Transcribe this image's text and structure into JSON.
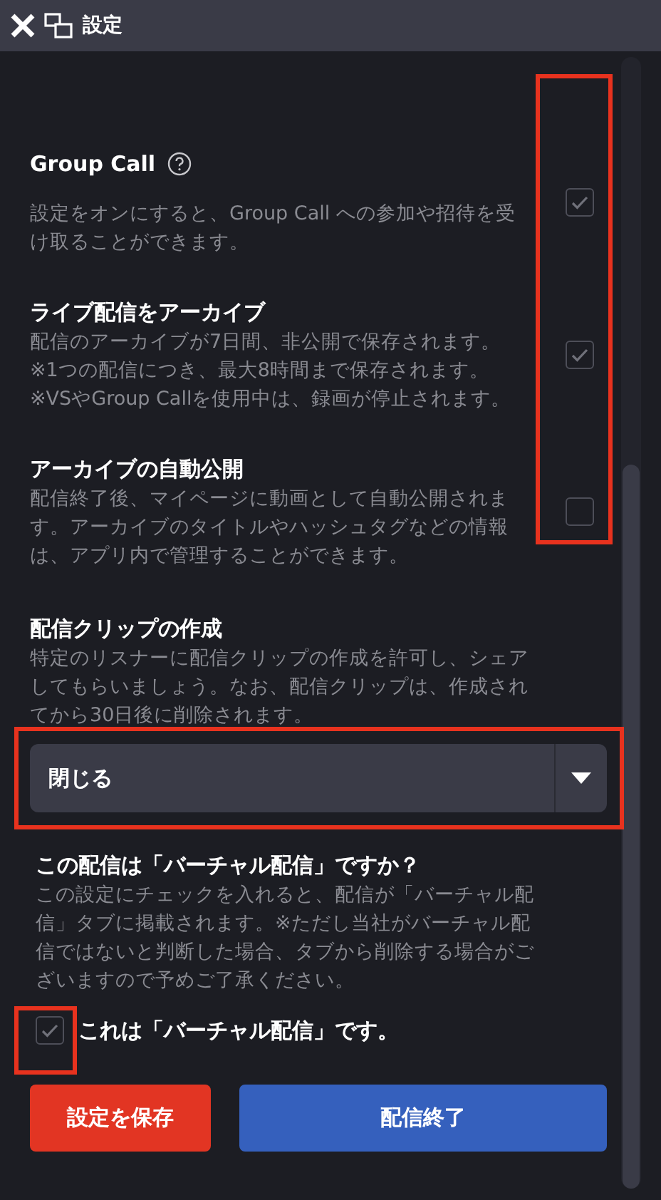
{
  "window": {
    "title": "設定"
  },
  "settings": [
    {
      "title": "Group Call",
      "help": true,
      "description": [
        "設定をオンにすると、Group Call への参加や招待を受け取ることができます。"
      ],
      "checked": true
    },
    {
      "title": "ライブ配信をアーカイブ",
      "help": false,
      "description": [
        "配信のアーカイブが7日間、非公開で保存されます。",
        "※1つの配信につき、最大8時間まで保存されます。",
        "※VSやGroup Callを使用中は、録画が停止されます。"
      ],
      "checked": true
    },
    {
      "title": "アーカイブの自動公開",
      "help": false,
      "description": [
        "配信終了後、マイページに動画として自動公開されます。アーカイブのタイトルやハッシュタグなどの情報は、アプリ内で管理することができます。"
      ],
      "checked": false
    }
  ],
  "settings_highlighted": true,
  "clip": {
    "title": "配信クリップの作成",
    "description": "特定のリスナーに配信クリップの作成を許可し、シェアしてもらいましょう。なお、配信クリップは、作成されてから30日後に削除されます。",
    "value": "閉じる",
    "highlighted": true
  },
  "virtual": {
    "title": "この配信は「バーチャル配信」ですか？",
    "description": "この設定にチェックを入れると、配信が「バーチャル配信」タブに掲載されます。※ただし当社がバーチャル配信ではないと判断した場合、タブから削除する場合がございますので予めご了承ください。",
    "checkbox_label": "これは「バーチャル配信」です。",
    "checked": true,
    "highlighted": true
  },
  "buttons": [
    {
      "label": "設定を保存",
      "kind": "save"
    },
    {
      "label": "配信終了",
      "kind": "end"
    }
  ]
}
